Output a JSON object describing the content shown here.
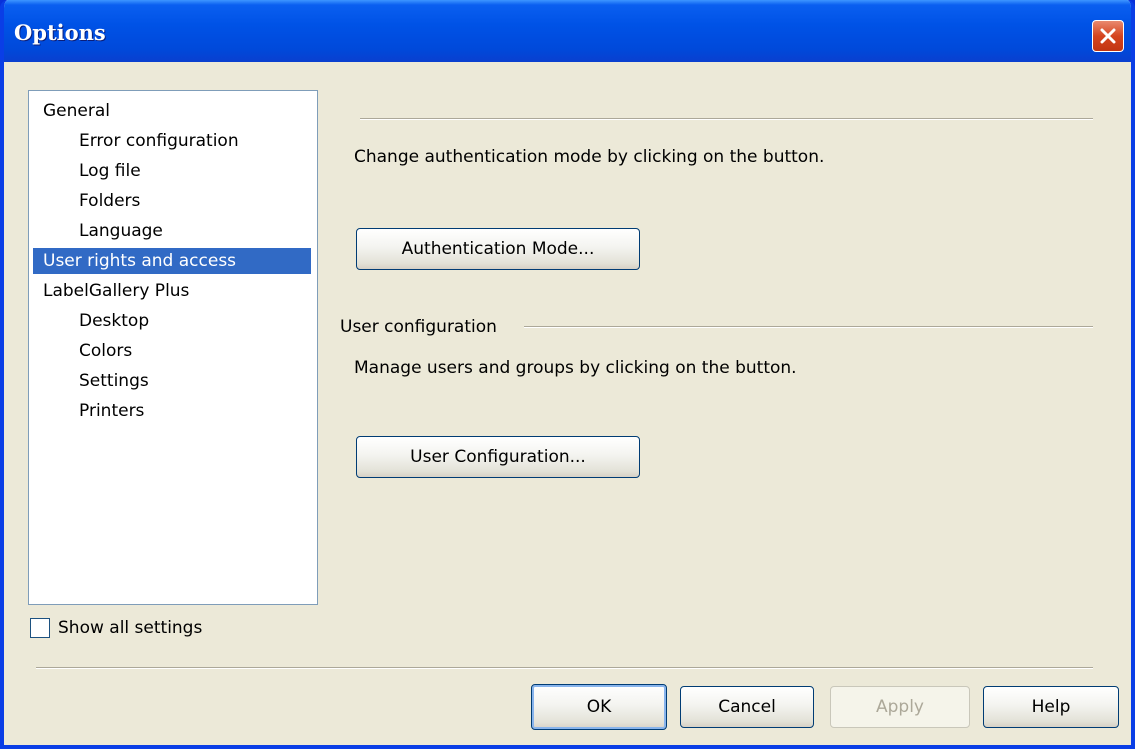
{
  "window": {
    "title": "Options"
  },
  "tree": {
    "items": [
      {
        "label": "General",
        "level": 0
      },
      {
        "label": "Error configuration",
        "level": 1
      },
      {
        "label": "Log file",
        "level": 1
      },
      {
        "label": "Folders",
        "level": 1
      },
      {
        "label": "Language",
        "level": 1
      },
      {
        "label": "User rights and access",
        "level": 0,
        "selected": true
      },
      {
        "label": "LabelGallery Plus",
        "level": 0
      },
      {
        "label": "Desktop",
        "level": 1
      },
      {
        "label": "Colors",
        "level": 1
      },
      {
        "label": "Settings",
        "level": 1
      },
      {
        "label": "Printers",
        "level": 1
      }
    ]
  },
  "show_all": {
    "label": "Show all settings",
    "checked": false
  },
  "auth": {
    "description": "Change authentication mode by clicking on the button.",
    "button_label": "Authentication Mode..."
  },
  "user_config": {
    "group_label": "User configuration",
    "description": "Manage users and groups by clicking on the button.",
    "button_label": "User Configuration..."
  },
  "footer": {
    "ok_label": "OK",
    "cancel_label": "Cancel",
    "apply_label": "Apply",
    "help_label": "Help"
  },
  "colors": {
    "selection": "#316ac5",
    "titlebar": "#0052e6",
    "dialog_bg": "#ece9d8"
  }
}
